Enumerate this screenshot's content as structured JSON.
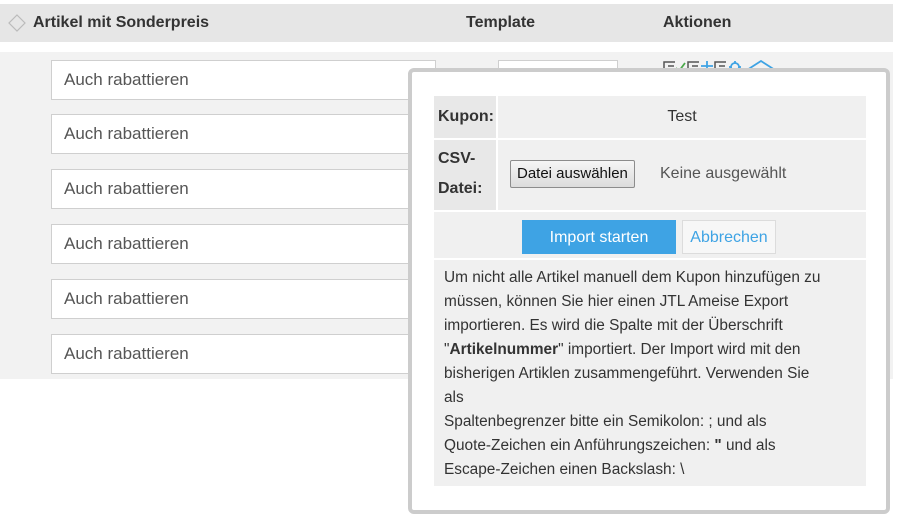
{
  "table": {
    "headers": {
      "artikel": "Artikel mit Sonderpreis",
      "template": "Template",
      "aktionen": "Aktionen"
    },
    "rows": [
      {
        "value": "Auch rabattieren"
      },
      {
        "value": "Auch rabattieren"
      },
      {
        "value": "Auch rabattieren"
      },
      {
        "value": "Auch rabattieren"
      },
      {
        "value": "Auch rabattieren"
      },
      {
        "value": "Auch rabattieren"
      }
    ],
    "action_icons": [
      "edit-icon",
      "check-icon",
      "plus-icon",
      "settings-icon",
      "home-icon"
    ]
  },
  "popup": {
    "kupon_label": "Kupon:",
    "kupon_value": "Test",
    "csv_label_line1": "CSV-",
    "csv_label_line2": "Datei:",
    "file_button": "Datei auswählen",
    "file_status": "Keine ausgewählt",
    "import_button": "Import starten",
    "cancel_button": "Abbrechen",
    "description": {
      "line1": "Um nicht alle Artikel manuell dem Kupon hinzufügen zu",
      "line2": "müssen, können Sie hier einen JTL Ameise Export",
      "line3": "importieren. Es wird die Spalte mit der Überschrift",
      "line4_pre": "\"",
      "line4_bold": "Artikelnummer",
      "line4_post": "\" importiert. Der Import wird mit den",
      "line5": "bisherigen Artiklen zusammengeführt. Verwenden Sie",
      "line6": "als",
      "line7": "Spaltenbegrenzer bitte ein Semikolon: ; und als",
      "line8_pre": "Quote-Zeichen ein Anführungszeichen: ",
      "line8_bold": "\"",
      "line8_post": " und als",
      "line9": "Escape-Zeichen einen Backslash: \\"
    }
  },
  "colors": {
    "accent": "#3ea3e4",
    "header_bg": "#e6e6e6",
    "popup_border": "#cccccc"
  }
}
